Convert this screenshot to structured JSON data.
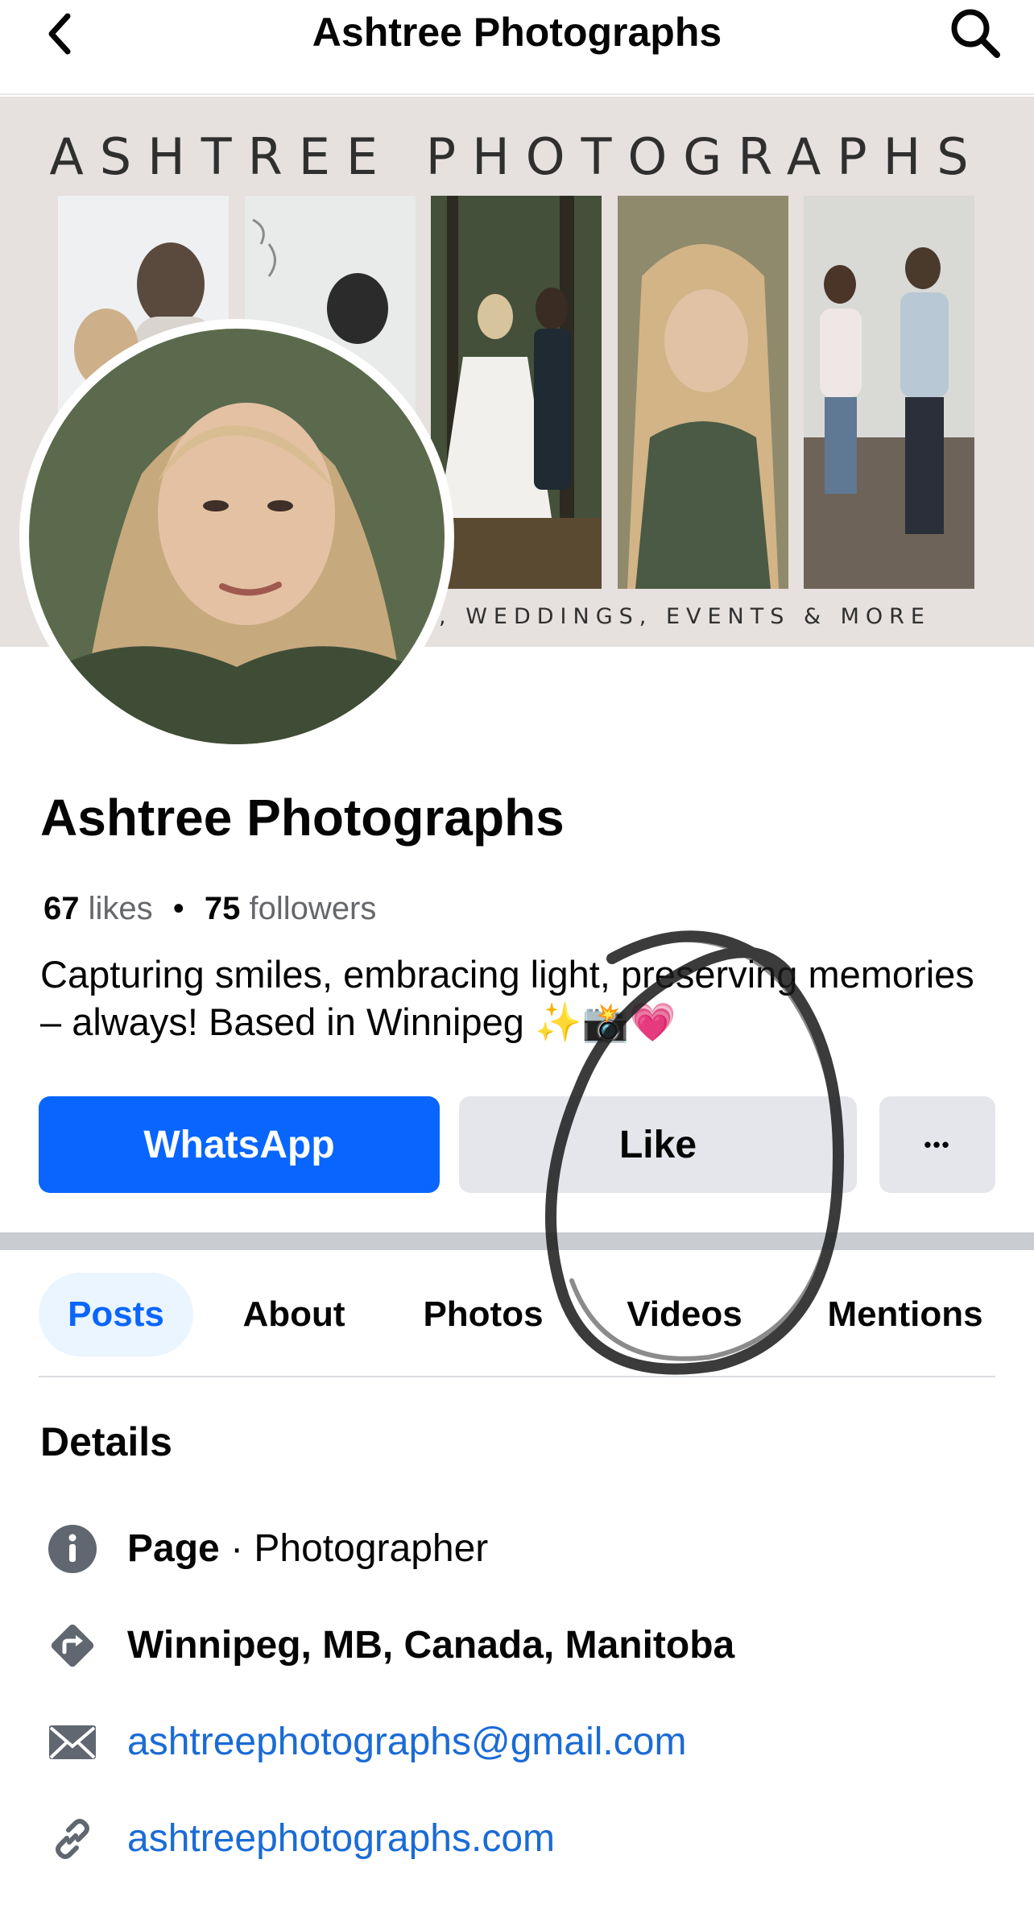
{
  "topbar": {
    "title": "Ashtree Photographs",
    "back_icon": "chevron-left-icon",
    "search_icon": "search-icon"
  },
  "cover": {
    "title": "ASHTREE PHOTOGRAPHS",
    "subtitle": "E, WEDDINGS, EVENTS & MORE"
  },
  "profile": {
    "name": "Ashtree Photographs",
    "likes_count": "67",
    "likes_label": "likes",
    "separator": "•",
    "followers_count": "75",
    "followers_label": "followers",
    "bio": "Capturing smiles, embracing light, preserving memories – always! Based in Winnipeg ✨📸💗"
  },
  "actions": {
    "whatsapp_label": "WhatsApp",
    "like_label": "Like",
    "more_label": "•••"
  },
  "tabs": [
    {
      "label": "Posts",
      "active": true
    },
    {
      "label": "About",
      "active": false
    },
    {
      "label": "Photos",
      "active": false
    },
    {
      "label": "Videos",
      "active": false
    },
    {
      "label": "Mentions",
      "active": false
    }
  ],
  "details": {
    "title": "Details",
    "page_label": "Page",
    "page_category": " · Photographer",
    "location": "Winnipeg, MB, Canada, Manitoba",
    "email": "ashtreephotographs@gmail.com",
    "website": "ashtreephotographs.com"
  },
  "colors": {
    "accent": "#0866ff",
    "link": "#1a6bd6",
    "button_gray": "#e4e6eb",
    "cover_bg": "#e6e0df"
  }
}
